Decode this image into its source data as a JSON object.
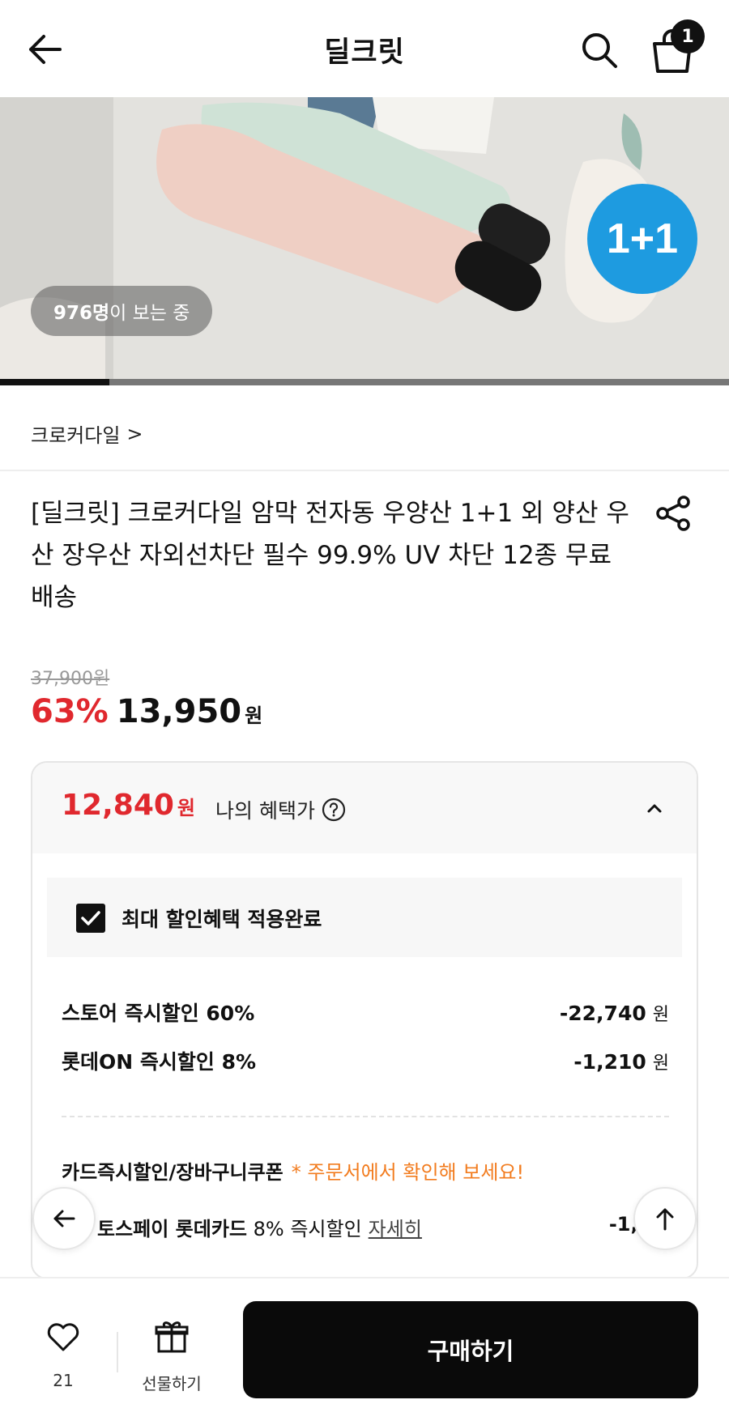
{
  "header": {
    "title": "딜크릿",
    "cart_count": "1"
  },
  "hero": {
    "viewers_count": "976명",
    "viewers_suffix": "이 보는 중",
    "badge_text": "1+1",
    "progress": 0.15
  },
  "brand": {
    "name": "크로커다일",
    "chevron": ">"
  },
  "product": {
    "title": "[딜크릿] 크로커다일 암막 전자동 우양산 1+1 외 양산 우산 장우산 자외선차단 필수 99.9% UV 차단 12종 무료배송"
  },
  "price": {
    "original": "37,900원",
    "discount_rate": "63%",
    "sale_price": "13,950",
    "won": "원"
  },
  "benefit": {
    "price": "12,840",
    "won": "원",
    "label": "나의 혜택가",
    "max_discount_label": "최대 할인혜택 적용완료",
    "discounts": [
      {
        "name": "스토어 즉시할인 60%",
        "amount": "-22,740",
        "unit": "원"
      },
      {
        "name": "롯데ON 즉시할인 8%",
        "amount": "-1,210",
        "unit": "원"
      }
    ],
    "card_section_title": "카드즉시할인/장바구니쿠폰",
    "card_section_note": "* 주문서에서 확인해 보세요!",
    "toss_name": "토스페이 롯데카드",
    "toss_rate": "8% 즉시할인",
    "toss_more": "자세히",
    "toss_amount": "-1,11("
  },
  "bottom": {
    "like_count": "21",
    "gift_label": "선물하기",
    "buy_label": "구매하기"
  },
  "colors": {
    "accent_red": "#e0282e",
    "note_orange": "#f27c1f",
    "badge_blue": "#1e9be0"
  }
}
